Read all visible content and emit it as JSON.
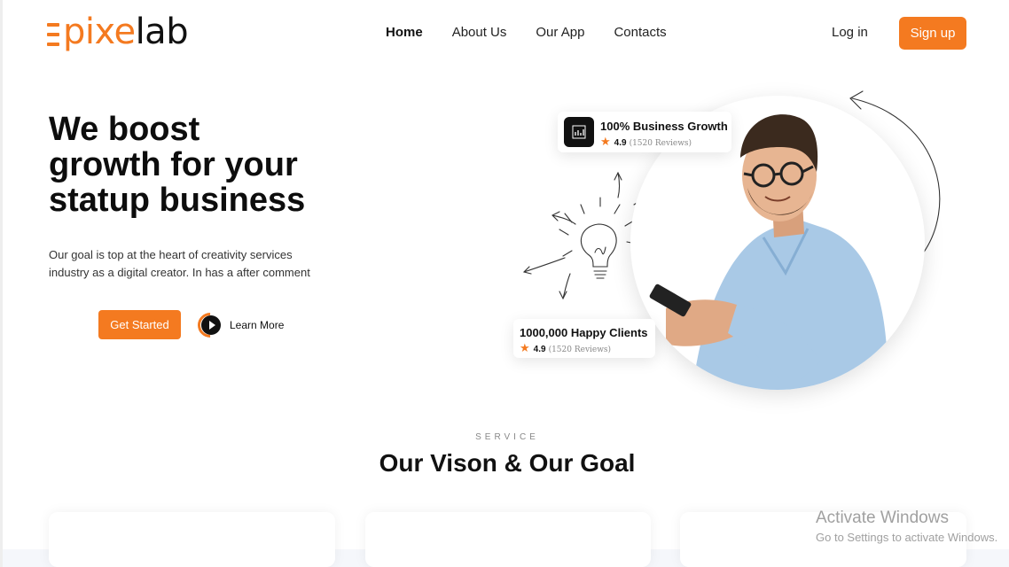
{
  "header": {
    "logo_prefix": "pixe",
    "logo_suffix": "lab",
    "nav": [
      {
        "label": "Home",
        "active": true
      },
      {
        "label": "About Us",
        "active": false
      },
      {
        "label": "Our App",
        "active": false
      },
      {
        "label": "Contacts",
        "active": false
      }
    ],
    "login_label": "Log in",
    "signup_label": "Sign up"
  },
  "hero": {
    "title_lines": [
      "We boost",
      "growth for your",
      "statup business"
    ],
    "subtitle_lines": [
      "Our goal is top at the heart of creativity services",
      "industry as a digital creator. In has a after comment"
    ],
    "get_started_label": "Get Started",
    "learn_more_label": "Learn More",
    "stat_cards": [
      {
        "title": "100% Business Growth",
        "rating": "4.9",
        "reviews": "(1520 Reviews)",
        "icon": "chart-icon"
      },
      {
        "title": "1000,000 Happy Clients",
        "rating": "4.9",
        "reviews": "(1520 Reviews)",
        "icon": "star-icon"
      }
    ]
  },
  "service": {
    "label": "SERVICE",
    "title": "Our Vison & Our Goal"
  },
  "watermark": {
    "line1": "Activate Windows",
    "line2": "Go to Settings to activate Windows."
  },
  "colors": {
    "accent": "#f47a20",
    "text": "#111111",
    "muted": "#888888"
  }
}
